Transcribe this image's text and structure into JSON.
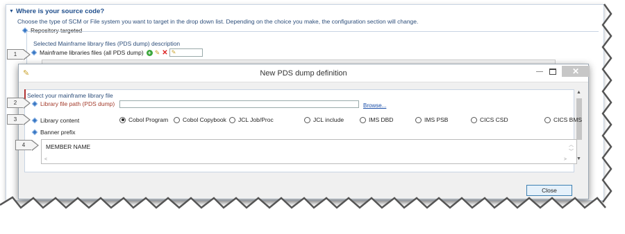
{
  "background": {
    "section_title": "Where is your source code?",
    "section_desc": "Choose the type of SCM or File system you want to target in the drop down list. Depending on the choice you make, the configuration section will change.",
    "repository_label": "Repository targeted",
    "group_title": "Selected Mainframe library files (PDS dump) description",
    "mainframe_label": "Mainframe libraries files (all PDS dump)"
  },
  "dialog": {
    "title": "New PDS dump definition",
    "select_label": "Select your mainframe library file",
    "file_path_label": "Library file path (PDS dump)",
    "browse_label": "Browse...",
    "library_content_label": "Library content",
    "radio_options": [
      {
        "label": "Cobol Program",
        "selected": true
      },
      {
        "label": "Cobol Copybook",
        "selected": false
      },
      {
        "label": "JCL Job/Proc",
        "selected": false
      },
      {
        "label": "JCL include",
        "selected": false
      },
      {
        "label": "IMS DBD",
        "selected": false
      },
      {
        "label": "IMS PSB",
        "selected": false
      },
      {
        "label": "CICS CSD",
        "selected": false
      },
      {
        "label": "CICS BMS",
        "selected": false
      }
    ],
    "banner_label": "Banner prefix",
    "banner_value": "MEMBER NAME",
    "close_label": "Close"
  },
  "callouts": [
    "1",
    "2",
    "3",
    "4"
  ],
  "colors": {
    "accent": "#1f4e8c",
    "required_label": "#a33a2a",
    "link": "#1a4ea8"
  }
}
